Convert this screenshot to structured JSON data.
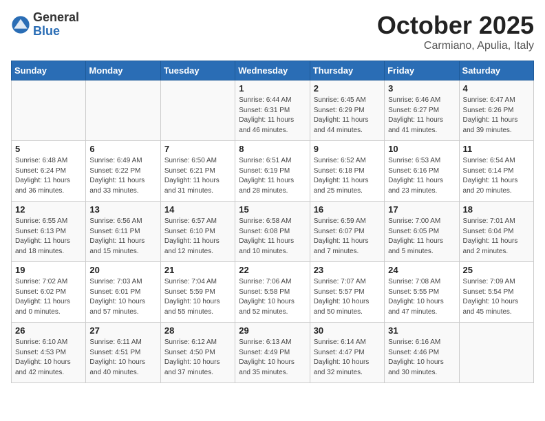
{
  "header": {
    "logo_general": "General",
    "logo_blue": "Blue",
    "month_title": "October 2025",
    "subtitle": "Carmiano, Apulia, Italy"
  },
  "weekdays": [
    "Sunday",
    "Monday",
    "Tuesday",
    "Wednesday",
    "Thursday",
    "Friday",
    "Saturday"
  ],
  "weeks": [
    [
      {
        "day": "",
        "info": ""
      },
      {
        "day": "",
        "info": ""
      },
      {
        "day": "",
        "info": ""
      },
      {
        "day": "1",
        "info": "Sunrise: 6:44 AM\nSunset: 6:31 PM\nDaylight: 11 hours\nand 46 minutes."
      },
      {
        "day": "2",
        "info": "Sunrise: 6:45 AM\nSunset: 6:29 PM\nDaylight: 11 hours\nand 44 minutes."
      },
      {
        "day": "3",
        "info": "Sunrise: 6:46 AM\nSunset: 6:27 PM\nDaylight: 11 hours\nand 41 minutes."
      },
      {
        "day": "4",
        "info": "Sunrise: 6:47 AM\nSunset: 6:26 PM\nDaylight: 11 hours\nand 39 minutes."
      }
    ],
    [
      {
        "day": "5",
        "info": "Sunrise: 6:48 AM\nSunset: 6:24 PM\nDaylight: 11 hours\nand 36 minutes."
      },
      {
        "day": "6",
        "info": "Sunrise: 6:49 AM\nSunset: 6:22 PM\nDaylight: 11 hours\nand 33 minutes."
      },
      {
        "day": "7",
        "info": "Sunrise: 6:50 AM\nSunset: 6:21 PM\nDaylight: 11 hours\nand 31 minutes."
      },
      {
        "day": "8",
        "info": "Sunrise: 6:51 AM\nSunset: 6:19 PM\nDaylight: 11 hours\nand 28 minutes."
      },
      {
        "day": "9",
        "info": "Sunrise: 6:52 AM\nSunset: 6:18 PM\nDaylight: 11 hours\nand 25 minutes."
      },
      {
        "day": "10",
        "info": "Sunrise: 6:53 AM\nSunset: 6:16 PM\nDaylight: 11 hours\nand 23 minutes."
      },
      {
        "day": "11",
        "info": "Sunrise: 6:54 AM\nSunset: 6:14 PM\nDaylight: 11 hours\nand 20 minutes."
      }
    ],
    [
      {
        "day": "12",
        "info": "Sunrise: 6:55 AM\nSunset: 6:13 PM\nDaylight: 11 hours\nand 18 minutes."
      },
      {
        "day": "13",
        "info": "Sunrise: 6:56 AM\nSunset: 6:11 PM\nDaylight: 11 hours\nand 15 minutes."
      },
      {
        "day": "14",
        "info": "Sunrise: 6:57 AM\nSunset: 6:10 PM\nDaylight: 11 hours\nand 12 minutes."
      },
      {
        "day": "15",
        "info": "Sunrise: 6:58 AM\nSunset: 6:08 PM\nDaylight: 11 hours\nand 10 minutes."
      },
      {
        "day": "16",
        "info": "Sunrise: 6:59 AM\nSunset: 6:07 PM\nDaylight: 11 hours\nand 7 minutes."
      },
      {
        "day": "17",
        "info": "Sunrise: 7:00 AM\nSunset: 6:05 PM\nDaylight: 11 hours\nand 5 minutes."
      },
      {
        "day": "18",
        "info": "Sunrise: 7:01 AM\nSunset: 6:04 PM\nDaylight: 11 hours\nand 2 minutes."
      }
    ],
    [
      {
        "day": "19",
        "info": "Sunrise: 7:02 AM\nSunset: 6:02 PM\nDaylight: 11 hours\nand 0 minutes."
      },
      {
        "day": "20",
        "info": "Sunrise: 7:03 AM\nSunset: 6:01 PM\nDaylight: 10 hours\nand 57 minutes."
      },
      {
        "day": "21",
        "info": "Sunrise: 7:04 AM\nSunset: 5:59 PM\nDaylight: 10 hours\nand 55 minutes."
      },
      {
        "day": "22",
        "info": "Sunrise: 7:06 AM\nSunset: 5:58 PM\nDaylight: 10 hours\nand 52 minutes."
      },
      {
        "day": "23",
        "info": "Sunrise: 7:07 AM\nSunset: 5:57 PM\nDaylight: 10 hours\nand 50 minutes."
      },
      {
        "day": "24",
        "info": "Sunrise: 7:08 AM\nSunset: 5:55 PM\nDaylight: 10 hours\nand 47 minutes."
      },
      {
        "day": "25",
        "info": "Sunrise: 7:09 AM\nSunset: 5:54 PM\nDaylight: 10 hours\nand 45 minutes."
      }
    ],
    [
      {
        "day": "26",
        "info": "Sunrise: 6:10 AM\nSunset: 4:53 PM\nDaylight: 10 hours\nand 42 minutes."
      },
      {
        "day": "27",
        "info": "Sunrise: 6:11 AM\nSunset: 4:51 PM\nDaylight: 10 hours\nand 40 minutes."
      },
      {
        "day": "28",
        "info": "Sunrise: 6:12 AM\nSunset: 4:50 PM\nDaylight: 10 hours\nand 37 minutes."
      },
      {
        "day": "29",
        "info": "Sunrise: 6:13 AM\nSunset: 4:49 PM\nDaylight: 10 hours\nand 35 minutes."
      },
      {
        "day": "30",
        "info": "Sunrise: 6:14 AM\nSunset: 4:47 PM\nDaylight: 10 hours\nand 32 minutes."
      },
      {
        "day": "31",
        "info": "Sunrise: 6:16 AM\nSunset: 4:46 PM\nDaylight: 10 hours\nand 30 minutes."
      },
      {
        "day": "",
        "info": ""
      }
    ]
  ]
}
